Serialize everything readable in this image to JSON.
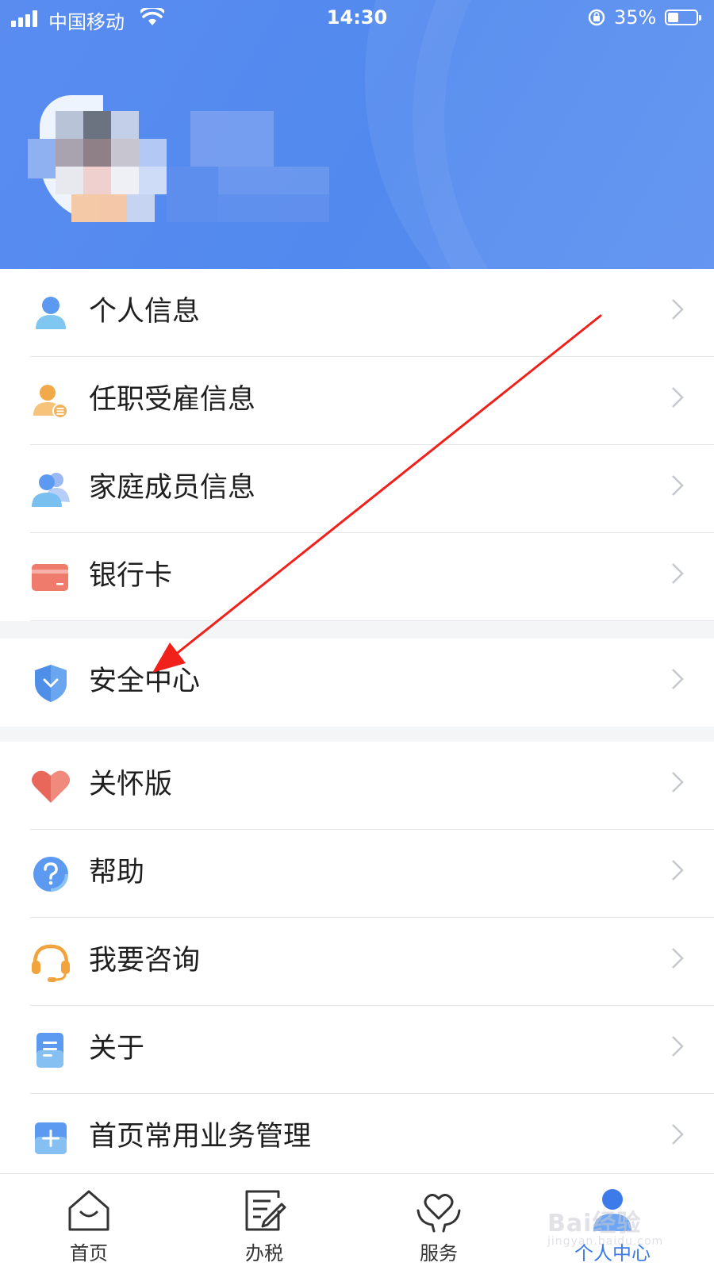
{
  "status_bar": {
    "carrier": "中国移动",
    "time": "14:30",
    "battery": "35%"
  },
  "colors": {
    "header": "#5189ee",
    "accent": "#3e7bea",
    "annotation_arrow": "#f0201a"
  },
  "menu_groups": [
    {
      "items": [
        {
          "label": "个人信息",
          "icon": "person-icon"
        },
        {
          "label": "任职受雇信息",
          "icon": "employment-icon"
        },
        {
          "label": "家庭成员信息",
          "icon": "family-members-icon"
        },
        {
          "label": "银行卡",
          "icon": "bank-card-icon"
        }
      ]
    },
    {
      "items": [
        {
          "label": "安全中心",
          "icon": "shield-icon"
        }
      ]
    },
    {
      "items": [
        {
          "label": "关怀版",
          "icon": "heart-icon"
        },
        {
          "label": "帮助",
          "icon": "question-icon"
        },
        {
          "label": "我要咨询",
          "icon": "headset-icon"
        },
        {
          "label": "关于",
          "icon": "document-icon"
        },
        {
          "label": "首页常用业务管理",
          "icon": "plus-icon"
        }
      ]
    }
  ],
  "tab_bar": {
    "tabs": [
      {
        "label": "首页",
        "icon": "home-icon"
      },
      {
        "label": "办税",
        "icon": "tax-form-icon"
      },
      {
        "label": "服务",
        "icon": "service-heart-icon"
      },
      {
        "label": "个人中心",
        "icon": "person-center-icon",
        "active": true
      }
    ]
  },
  "watermark": {
    "text": "Bai经验",
    "url_text": "jingyan.baidu.com"
  }
}
